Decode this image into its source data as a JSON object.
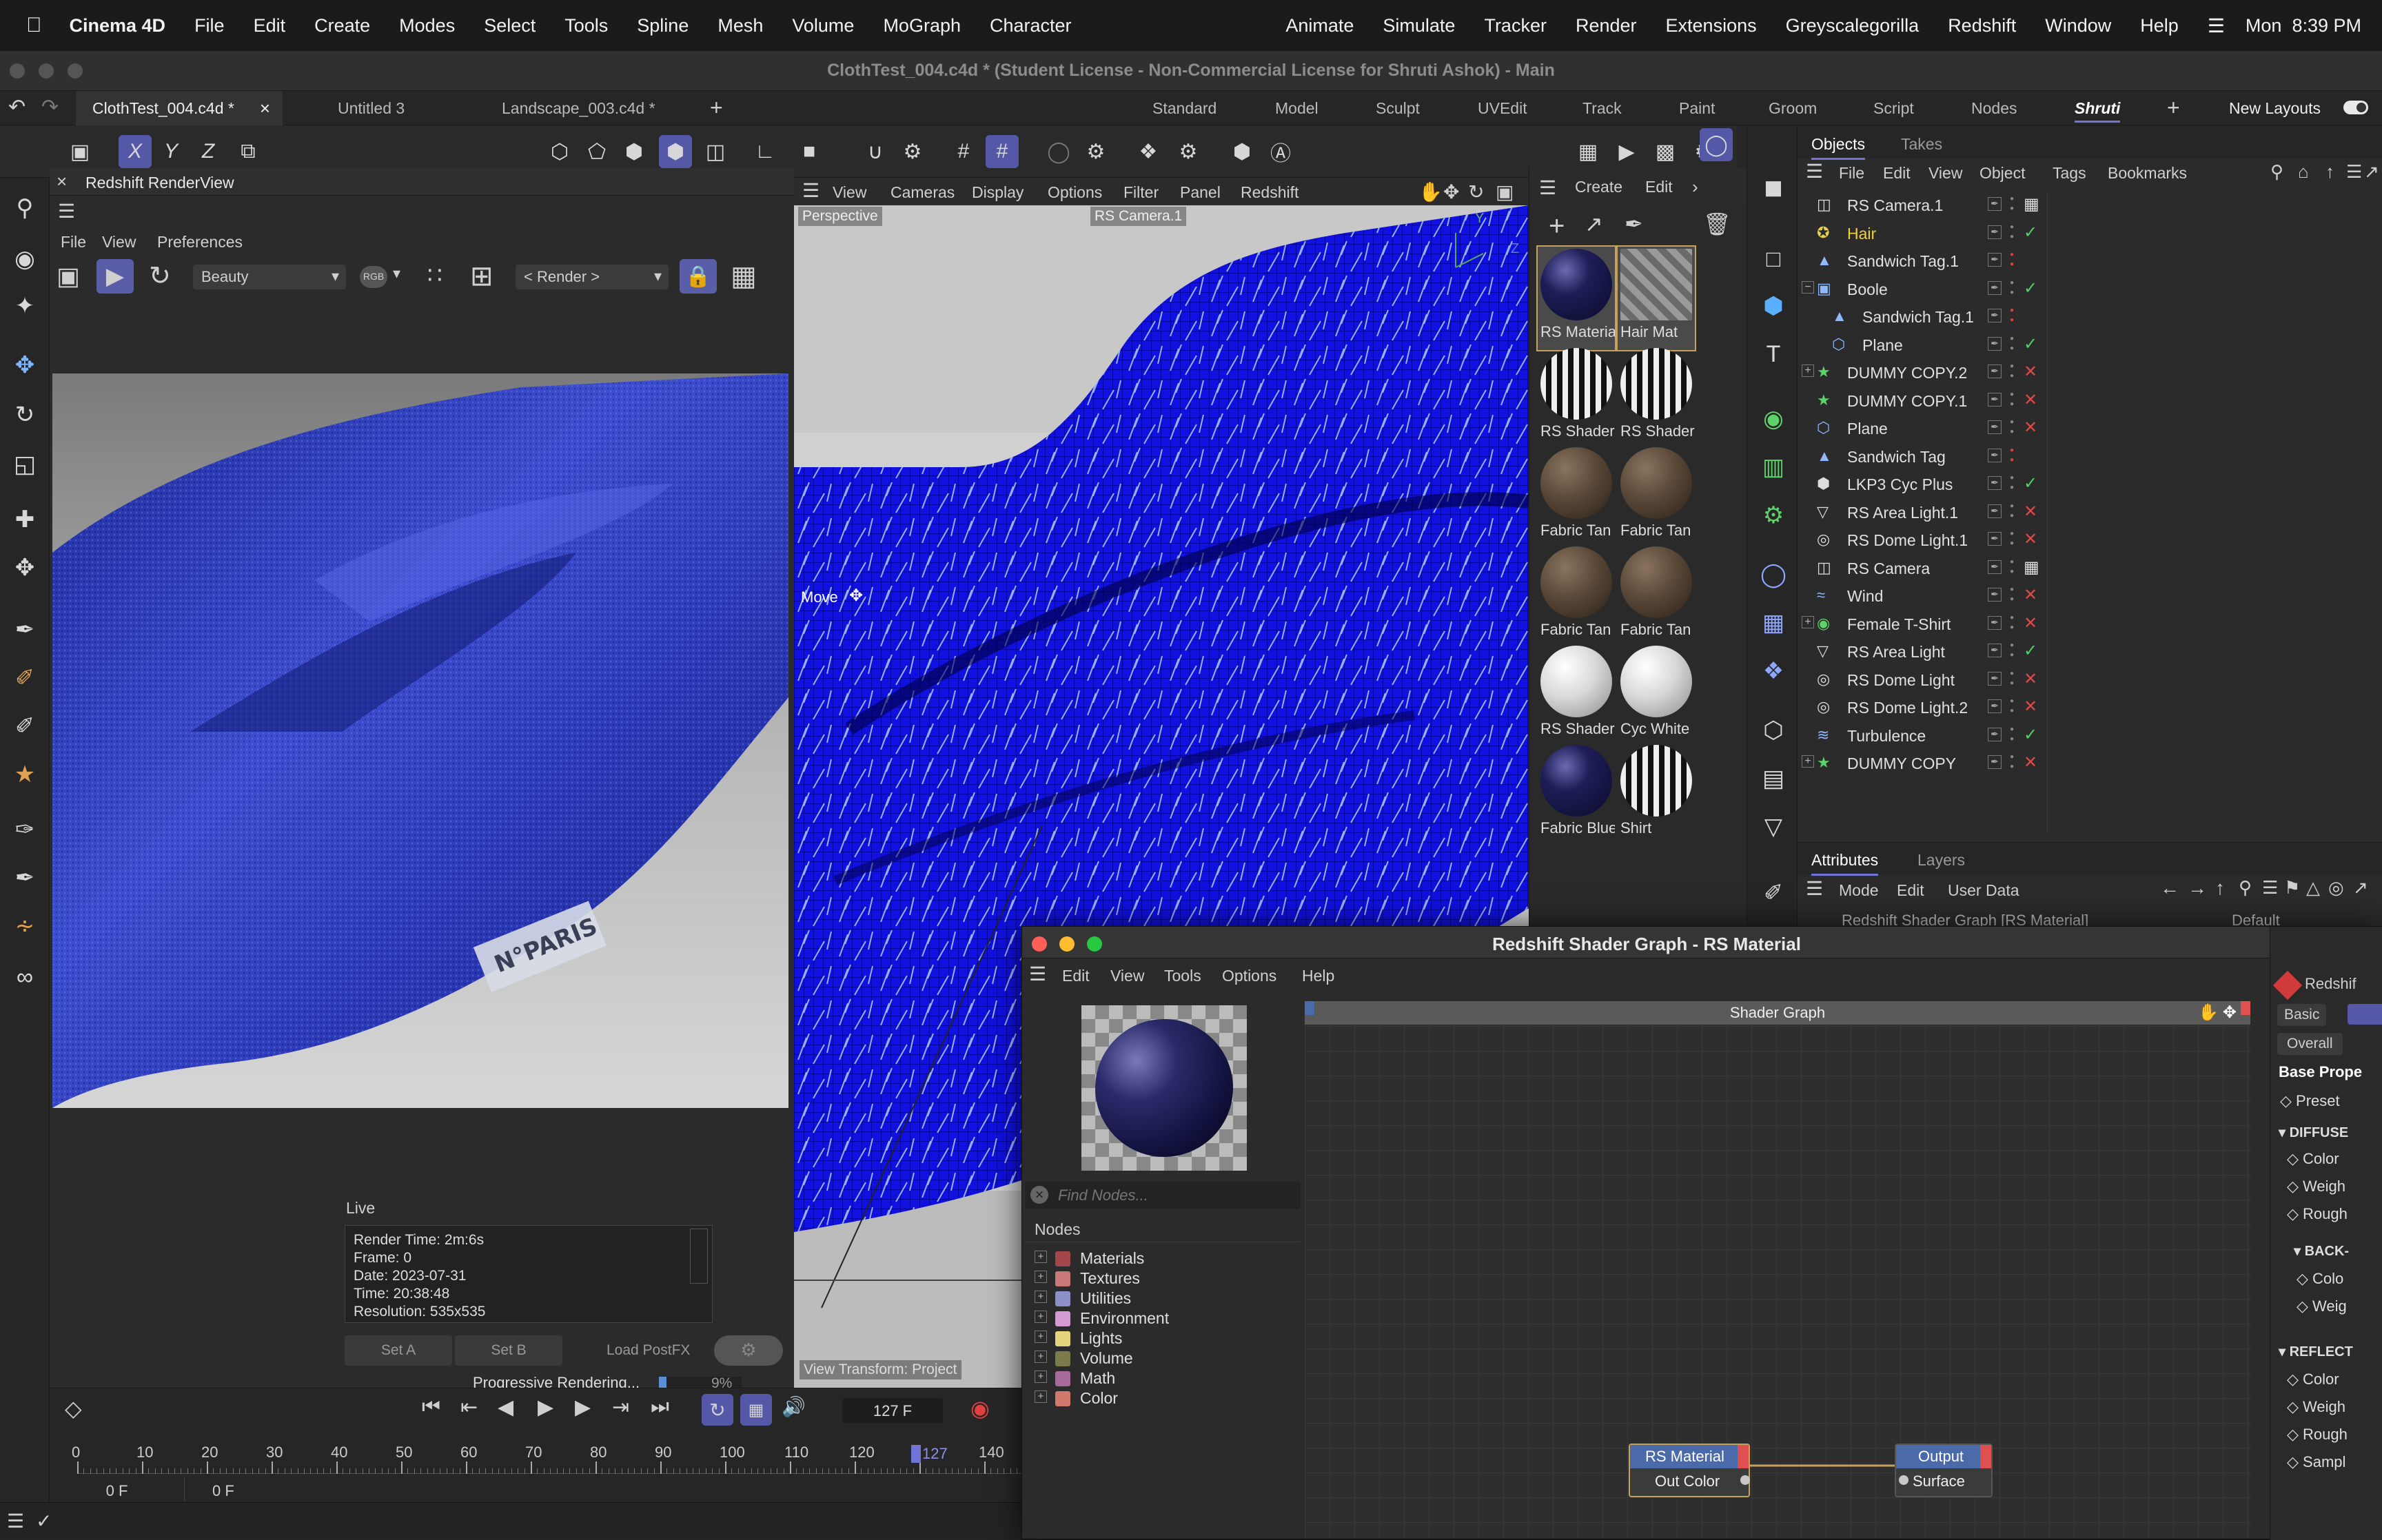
{
  "menubar": {
    "app_name": "Cinema 4D",
    "items": [
      "File",
      "Edit",
      "Create",
      "Modes",
      "Select",
      "Tools",
      "Spline",
      "Mesh",
      "Volume",
      "MoGraph",
      "Character"
    ],
    "right_items": [
      "Animate",
      "Simulate",
      "Tracker",
      "Render",
      "Extensions",
      "Greyscalegorilla",
      "Redshift",
      "Window",
      "Help"
    ],
    "clock": "Mon  8:39 PM"
  },
  "window": {
    "title": "ClothTest_004.c4d * (Student License - Non-Commercial License for Shruti Ashok) - Main"
  },
  "doc_tabs": [
    {
      "label": "ClothTest_004.c4d *",
      "close": "×"
    },
    {
      "label": "Untitled 3"
    },
    {
      "label": "Landscape_003.c4d *"
    }
  ],
  "layout_tabs": [
    "Standard",
    "Model",
    "Sculpt",
    "UVEdit",
    "Track",
    "Paint",
    "Groom",
    "Script",
    "Nodes",
    "Shruti"
  ],
  "layout_active": "Shruti",
  "new_layouts": "New Layouts",
  "toolbar": {
    "axis": [
      "X",
      "Y",
      "Z"
    ]
  },
  "renderview": {
    "title": "Redshift RenderView",
    "menu": [
      "File",
      "View",
      "Preferences"
    ],
    "aov": "Beauty",
    "rgb": "RGB",
    "render_sel": "< Render >",
    "label_text": "N°PARIS",
    "live": "Live",
    "info": [
      "Render Time: 2m:6s",
      "Frame: 0",
      "Date: 2023-07-31",
      "Time: 20:38:48",
      "Resolution: 535x535"
    ],
    "buttons": [
      "Set A",
      "Set B",
      "Load PostFX"
    ],
    "progress_label": "Progressive Rendering...",
    "progress_value": 9,
    "progress_text": "9%"
  },
  "viewport": {
    "menu": [
      "View",
      "Cameras",
      "Display",
      "Options",
      "Filter",
      "Panel",
      "Redshift"
    ],
    "label_persp": "Perspective",
    "label_cam": "RS Camera.1",
    "move": "Move",
    "view_transform": "View Transform: Project",
    "axis_y": "Y",
    "axis_z": "Z"
  },
  "materials": {
    "menu": [
      "Create",
      "Edit"
    ],
    "items": [
      {
        "label": "RS Materia",
        "kind": "navy",
        "selected": true
      },
      {
        "label": "Hair Mat",
        "kind": "stripe",
        "selected": true
      },
      {
        "label": "RS Shader",
        "kind": "zebra"
      },
      {
        "label": "RS Shader",
        "kind": "zebra"
      },
      {
        "label": "Fabric Tan",
        "kind": "brown"
      },
      {
        "label": "Fabric Tan",
        "kind": "brown"
      },
      {
        "label": "Fabric Tan",
        "kind": "brown"
      },
      {
        "label": "Fabric Tan",
        "kind": "brown"
      },
      {
        "label": "RS Shader",
        "kind": "white"
      },
      {
        "label": "Cyc White",
        "kind": "white"
      },
      {
        "label": "Fabric Blue",
        "kind": "navy"
      },
      {
        "label": "Shirt",
        "kind": "zebra"
      }
    ]
  },
  "objects": {
    "tabs": [
      "Objects",
      "Takes"
    ],
    "menu": [
      "File",
      "Edit",
      "View",
      "Object",
      "Tags",
      "Bookmarks"
    ],
    "rows": [
      {
        "name": "RS Camera.1",
        "indent": 0,
        "state": "none",
        "icon": "camera"
      },
      {
        "name": "Hair",
        "indent": 0,
        "state": "check",
        "icon": "hair",
        "highlight": true
      },
      {
        "name": "Sandwich Tag.1",
        "indent": 0,
        "state": "dot",
        "icon": "tag"
      },
      {
        "name": "Boole",
        "indent": 0,
        "state": "check",
        "icon": "boole",
        "expand": "−"
      },
      {
        "name": "Sandwich Tag.1",
        "indent": 1,
        "state": "dot",
        "icon": "tag"
      },
      {
        "name": "Plane",
        "indent": 1,
        "state": "check",
        "icon": "plane"
      },
      {
        "name": "DUMMY COPY.2",
        "indent": 0,
        "state": "x",
        "icon": "dummy",
        "expand": "+"
      },
      {
        "name": "DUMMY COPY.1",
        "indent": 0,
        "state": "x",
        "icon": "dummy"
      },
      {
        "name": "Plane",
        "indent": 0,
        "state": "x",
        "icon": "plane"
      },
      {
        "name": "Sandwich Tag",
        "indent": 0,
        "state": "dot",
        "icon": "tag"
      },
      {
        "name": "LKP3 Cyc Plus",
        "indent": 0,
        "state": "check",
        "icon": "cyc"
      },
      {
        "name": "RS Area Light.1",
        "indent": 0,
        "state": "x",
        "icon": "light"
      },
      {
        "name": "RS Dome Light.1",
        "indent": 0,
        "state": "x",
        "icon": "dome"
      },
      {
        "name": "RS Camera",
        "indent": 0,
        "state": "none",
        "icon": "camera"
      },
      {
        "name": "Wind",
        "indent": 0,
        "state": "x",
        "icon": "wind"
      },
      {
        "name": "Female T-Shirt",
        "indent": 0,
        "state": "x",
        "icon": "group",
        "expand": "+"
      },
      {
        "name": "RS Area Light",
        "indent": 0,
        "state": "check",
        "icon": "light"
      },
      {
        "name": "RS Dome Light",
        "indent": 0,
        "state": "x",
        "icon": "dome"
      },
      {
        "name": "RS Dome Light.2",
        "indent": 0,
        "state": "x",
        "icon": "dome"
      },
      {
        "name": "Turbulence",
        "indent": 0,
        "state": "check",
        "icon": "turb"
      },
      {
        "name": "DUMMY COPY",
        "indent": 0,
        "state": "x",
        "icon": "dummy",
        "expand": "+"
      }
    ]
  },
  "attributes": {
    "tabs": [
      "Attributes",
      "Layers"
    ],
    "menu": [
      "Mode",
      "Edit",
      "User Data"
    ],
    "object": "Redshift Shader Graph [RS Material]",
    "preset_value": "Default"
  },
  "timeline": {
    "ticks": [
      "0",
      "10",
      "20",
      "30",
      "40",
      "50",
      "60",
      "70",
      "80",
      "90",
      "100",
      "110",
      "120",
      "",
      "140"
    ],
    "current_marker": "127",
    "frame_field": "127 F",
    "start": "0 F",
    "end": "0 F"
  },
  "shader": {
    "title": "Redshift Shader Graph - RS Material",
    "menu": [
      "Edit",
      "View",
      "Tools",
      "Options",
      "Help"
    ],
    "find_placeholder": "Find Nodes...",
    "nodes_header": "Nodes",
    "categories": [
      {
        "label": "Materials",
        "color": "#a4474a"
      },
      {
        "label": "Textures",
        "color": "#c9787a"
      },
      {
        "label": "Utilities",
        "color": "#8d90c8"
      },
      {
        "label": "Environment",
        "color": "#d39bd2"
      },
      {
        "label": "Lights",
        "color": "#e6d47c"
      },
      {
        "label": "Volume",
        "color": "#7a7a4a"
      },
      {
        "label": "Math",
        "color": "#a86a9a"
      },
      {
        "label": "Color",
        "color": "#d07a6e"
      }
    ],
    "graph_title": "Shader Graph",
    "node_mat": {
      "title": "RS Material",
      "port": "Out Color"
    },
    "node_out": {
      "title": "Output",
      "port": "Surface"
    },
    "attr": {
      "name": "Redshif",
      "tabs": [
        "Basic",
        "Overall"
      ],
      "base": "Base Prope",
      "preset": "Preset",
      "diffuse": "DIFFUSE",
      "diffuse_items": [
        "Color",
        "Weigh",
        "Rough"
      ],
      "back": "BACK-",
      "back_items": [
        "Colo",
        "Weig"
      ],
      "reflect": "REFLECT",
      "reflect_items": [
        "Color",
        "Weigh",
        "Rough",
        "Sampl"
      ]
    }
  }
}
